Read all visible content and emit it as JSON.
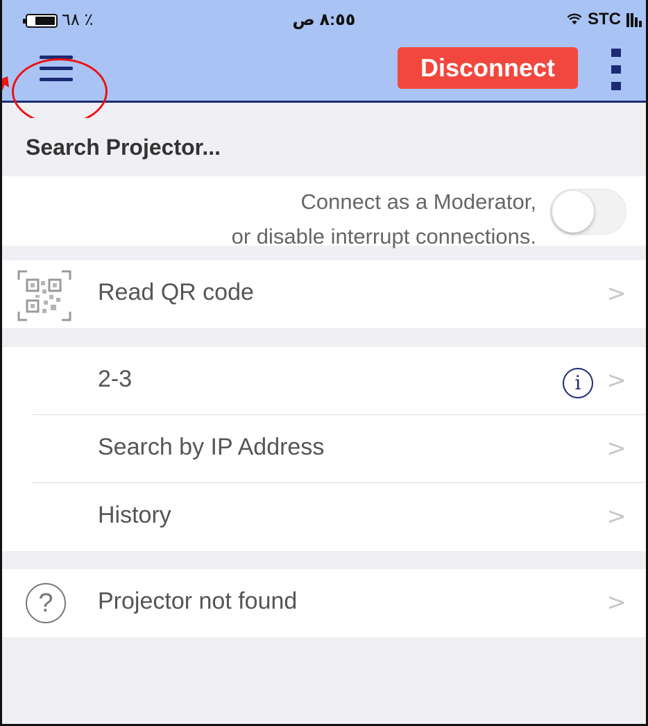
{
  "status_bar": {
    "battery_percent": "٦٨ ٪",
    "time": "٨:٥٥ ص",
    "carrier": "STC"
  },
  "nav": {
    "disconnect_label": "Disconnect",
    "menu_icon": "hamburger-menu-icon",
    "more_icon": "more-vertical-icon"
  },
  "section": {
    "title": "Search Projector..."
  },
  "moderator": {
    "line1": "Connect as a Moderator,",
    "line2": "or disable interrupt connections.",
    "toggle_on": false
  },
  "qr_row": {
    "label": "Read QR code",
    "chevron": ">"
  },
  "projector_list": [
    {
      "label": "2-3",
      "chevron": ">",
      "info": "i"
    },
    {
      "label": "Search by IP Address",
      "chevron": ">"
    },
    {
      "label": "History",
      "chevron": ">"
    }
  ],
  "help_row": {
    "label": "Projector not found",
    "chevron": ">",
    "icon": "?"
  },
  "colors": {
    "nav_bg": "#a9c4f4",
    "accent": "#1c2a74",
    "disconnect": "#f2473e",
    "annotation": "#ee1111"
  }
}
